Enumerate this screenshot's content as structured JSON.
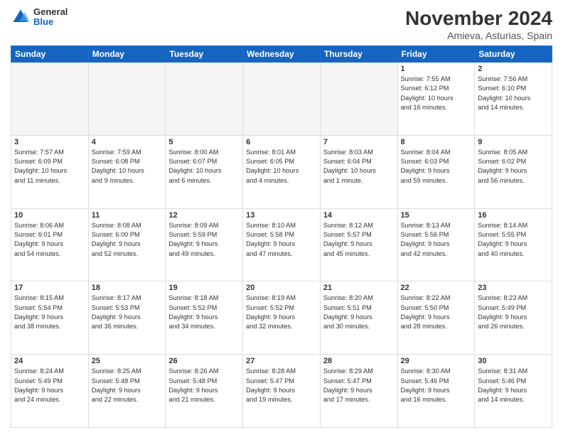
{
  "header": {
    "logo": {
      "line1": "General",
      "line2": "Blue"
    },
    "title": "November 2024",
    "location": "Amieva, Asturias, Spain"
  },
  "weekdays": [
    "Sunday",
    "Monday",
    "Tuesday",
    "Wednesday",
    "Thursday",
    "Friday",
    "Saturday"
  ],
  "weeks": [
    [
      {
        "day": "",
        "info": ""
      },
      {
        "day": "",
        "info": ""
      },
      {
        "day": "",
        "info": ""
      },
      {
        "day": "",
        "info": ""
      },
      {
        "day": "",
        "info": ""
      },
      {
        "day": "1",
        "info": "Sunrise: 7:55 AM\nSunset: 6:12 PM\nDaylight: 10 hours\nand 16 minutes."
      },
      {
        "day": "2",
        "info": "Sunrise: 7:56 AM\nSunset: 6:10 PM\nDaylight: 10 hours\nand 14 minutes."
      }
    ],
    [
      {
        "day": "3",
        "info": "Sunrise: 7:57 AM\nSunset: 6:09 PM\nDaylight: 10 hours\nand 11 minutes."
      },
      {
        "day": "4",
        "info": "Sunrise: 7:59 AM\nSunset: 6:08 PM\nDaylight: 10 hours\nand 9 minutes."
      },
      {
        "day": "5",
        "info": "Sunrise: 8:00 AM\nSunset: 6:07 PM\nDaylight: 10 hours\nand 6 minutes."
      },
      {
        "day": "6",
        "info": "Sunrise: 8:01 AM\nSunset: 6:05 PM\nDaylight: 10 hours\nand 4 minutes."
      },
      {
        "day": "7",
        "info": "Sunrise: 8:03 AM\nSunset: 6:04 PM\nDaylight: 10 hours\nand 1 minute."
      },
      {
        "day": "8",
        "info": "Sunrise: 8:04 AM\nSunset: 6:03 PM\nDaylight: 9 hours\nand 59 minutes."
      },
      {
        "day": "9",
        "info": "Sunrise: 8:05 AM\nSunset: 6:02 PM\nDaylight: 9 hours\nand 56 minutes."
      }
    ],
    [
      {
        "day": "10",
        "info": "Sunrise: 8:06 AM\nSunset: 6:01 PM\nDaylight: 9 hours\nand 54 minutes."
      },
      {
        "day": "11",
        "info": "Sunrise: 8:08 AM\nSunset: 6:00 PM\nDaylight: 9 hours\nand 52 minutes."
      },
      {
        "day": "12",
        "info": "Sunrise: 8:09 AM\nSunset: 5:59 PM\nDaylight: 9 hours\nand 49 minutes."
      },
      {
        "day": "13",
        "info": "Sunrise: 8:10 AM\nSunset: 5:58 PM\nDaylight: 9 hours\nand 47 minutes."
      },
      {
        "day": "14",
        "info": "Sunrise: 8:12 AM\nSunset: 5:57 PM\nDaylight: 9 hours\nand 45 minutes."
      },
      {
        "day": "15",
        "info": "Sunrise: 8:13 AM\nSunset: 5:56 PM\nDaylight: 9 hours\nand 42 minutes."
      },
      {
        "day": "16",
        "info": "Sunrise: 8:14 AM\nSunset: 5:55 PM\nDaylight: 9 hours\nand 40 minutes."
      }
    ],
    [
      {
        "day": "17",
        "info": "Sunrise: 8:15 AM\nSunset: 5:54 PM\nDaylight: 9 hours\nand 38 minutes."
      },
      {
        "day": "18",
        "info": "Sunrise: 8:17 AM\nSunset: 5:53 PM\nDaylight: 9 hours\nand 36 minutes."
      },
      {
        "day": "19",
        "info": "Sunrise: 8:18 AM\nSunset: 5:52 PM\nDaylight: 9 hours\nand 34 minutes."
      },
      {
        "day": "20",
        "info": "Sunrise: 8:19 AM\nSunset: 5:52 PM\nDaylight: 9 hours\nand 32 minutes."
      },
      {
        "day": "21",
        "info": "Sunrise: 8:20 AM\nSunset: 5:51 PM\nDaylight: 9 hours\nand 30 minutes."
      },
      {
        "day": "22",
        "info": "Sunrise: 8:22 AM\nSunset: 5:50 PM\nDaylight: 9 hours\nand 28 minutes."
      },
      {
        "day": "23",
        "info": "Sunrise: 8:23 AM\nSunset: 5:49 PM\nDaylight: 9 hours\nand 26 minutes."
      }
    ],
    [
      {
        "day": "24",
        "info": "Sunrise: 8:24 AM\nSunset: 5:49 PM\nDaylight: 9 hours\nand 24 minutes."
      },
      {
        "day": "25",
        "info": "Sunrise: 8:25 AM\nSunset: 5:48 PM\nDaylight: 9 hours\nand 22 minutes."
      },
      {
        "day": "26",
        "info": "Sunrise: 8:26 AM\nSunset: 5:48 PM\nDaylight: 9 hours\nand 21 minutes."
      },
      {
        "day": "27",
        "info": "Sunrise: 8:28 AM\nSunset: 5:47 PM\nDaylight: 9 hours\nand 19 minutes."
      },
      {
        "day": "28",
        "info": "Sunrise: 8:29 AM\nSunset: 5:47 PM\nDaylight: 9 hours\nand 17 minutes."
      },
      {
        "day": "29",
        "info": "Sunrise: 8:30 AM\nSunset: 5:46 PM\nDaylight: 9 hours\nand 16 minutes."
      },
      {
        "day": "30",
        "info": "Sunrise: 8:31 AM\nSunset: 5:46 PM\nDaylight: 9 hours\nand 14 minutes."
      }
    ]
  ]
}
